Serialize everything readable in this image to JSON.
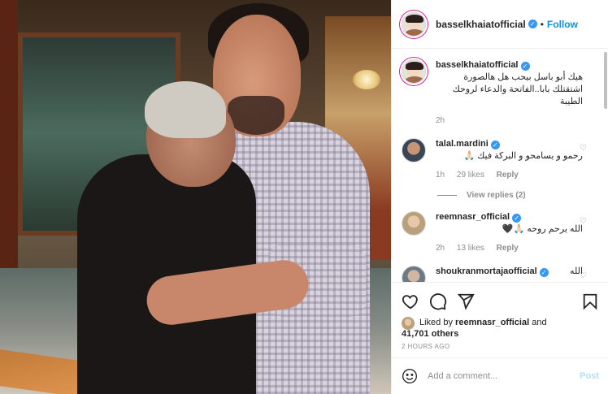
{
  "post": {
    "author": "basselkhaiatofficial",
    "follow_label": "Follow",
    "dot": "•",
    "caption": "هيك أبو باسل بيحب هل هالصورة اشتقتلك بابا..الفاتحة والدعاء لروحك الطيبة",
    "caption_time": "2h"
  },
  "comments": [
    {
      "user": "talal.mardini",
      "text": "رحمو و يسامحو و البركة فيك 🙏🏻",
      "time": "1h",
      "likes": "29 likes",
      "reply": "Reply",
      "view_replies": "View replies (2)"
    },
    {
      "user": "reemnasr_official",
      "text": "الله يرحم روحه 🙏🏻🖤",
      "time": "2h",
      "likes": "13 likes",
      "reply": "Reply"
    },
    {
      "user": "shoukranmortajaofficial",
      "text": "الله"
    }
  ],
  "likes": {
    "prefix": "Liked by",
    "user": "reemnasr_official",
    "and": "and",
    "others": "41,701 others"
  },
  "time_ago": "2 HOURS AGO",
  "add_comment": {
    "placeholder": "Add a comment...",
    "post_label": "Post"
  },
  "icons": {
    "like": "heart-icon",
    "comment": "comment-icon",
    "share": "paper-plane-icon",
    "save": "bookmark-icon",
    "emoji": "smiley-icon",
    "verified": "verified-badge-icon"
  },
  "colors": {
    "link": "#0095f6",
    "verified": "#3897f0",
    "muted": "#8e8e8e",
    "post_disabled": "#b2dffc"
  }
}
